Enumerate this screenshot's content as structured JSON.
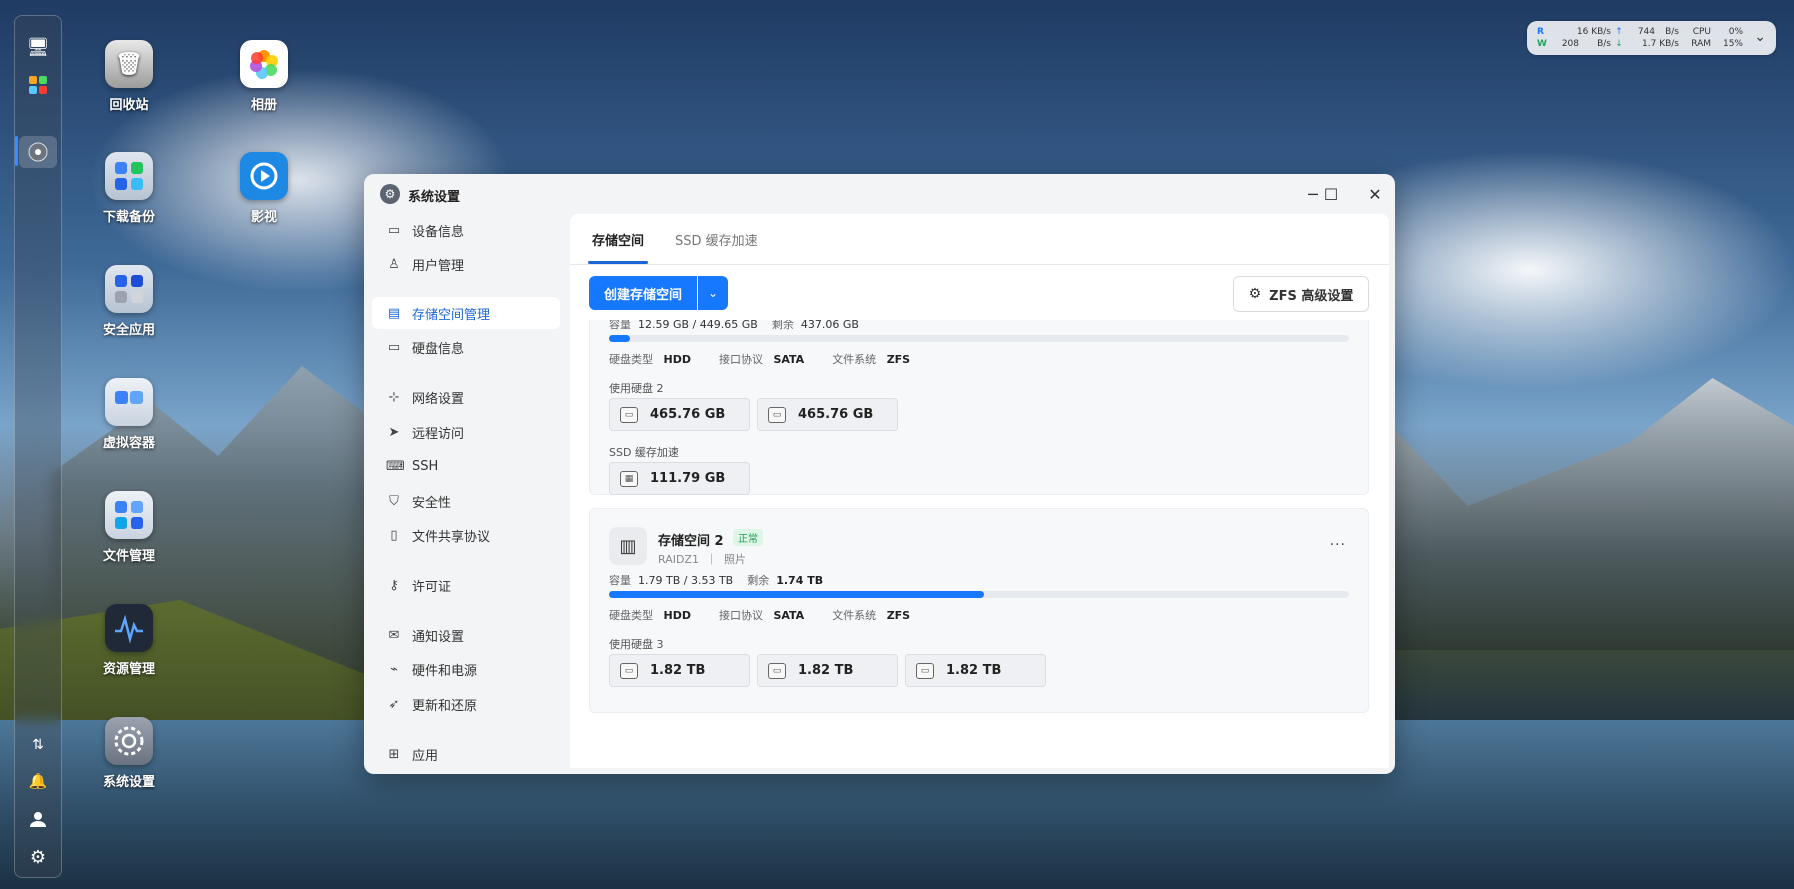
{
  "desktop": {
    "icons": [
      {
        "label": "回收站",
        "icon": "trash-icon"
      },
      {
        "label": "相册",
        "icon": "photos-icon"
      },
      {
        "label": "下载备份",
        "icon": "download-backup-icon"
      },
      {
        "label": "影视",
        "icon": "video-icon"
      },
      {
        "label": "安全应用",
        "icon": "security-apps-icon"
      },
      {
        "label": "虚拟容器",
        "icon": "virtual-container-icon"
      },
      {
        "label": "文件管理",
        "icon": "file-manager-icon"
      },
      {
        "label": "资源管理",
        "icon": "resource-monitor-icon"
      },
      {
        "label": "系统设置",
        "icon": "settings-icon"
      }
    ]
  },
  "status_widget": {
    "r_label": "R",
    "r_speed": "16 KB/s",
    "r_up": "744",
    "r_unit": "B/s",
    "cpu_label": "CPU",
    "cpu_value": "0%",
    "w_label": "W",
    "w_speed": "208",
    "w_speed_unit": "B/s",
    "w_down": "1.7 KB/s",
    "ram_label": "RAM",
    "ram_value": "15%"
  },
  "window": {
    "title": "系统设置",
    "nav": [
      {
        "label": "设备信息",
        "icon": "device-icon"
      },
      {
        "label": "用户管理",
        "icon": "user-icon"
      },
      {
        "label": "存储空间管理",
        "icon": "storage-icon",
        "active": true
      },
      {
        "label": "硬盘信息",
        "icon": "disk-icon"
      },
      {
        "label": "网络设置",
        "icon": "network-icon"
      },
      {
        "label": "远程访问",
        "icon": "remote-icon"
      },
      {
        "label": "SSH",
        "icon": "ssh-icon"
      },
      {
        "label": "安全性",
        "icon": "shield-icon"
      },
      {
        "label": "文件共享协议",
        "icon": "file-share-icon"
      },
      {
        "label": "许可证",
        "icon": "license-icon"
      },
      {
        "label": "通知设置",
        "icon": "mail-icon"
      },
      {
        "label": "硬件和电源",
        "icon": "power-icon"
      },
      {
        "label": "更新和还原",
        "icon": "rocket-icon"
      },
      {
        "label": "应用",
        "icon": "apps-icon"
      }
    ],
    "tabs": [
      "存储空间",
      "SSD 缓存加速"
    ],
    "create_button": "创建存储空间",
    "zfs_button": "ZFS 高级设置",
    "pool1": {
      "capacity_label": "容量",
      "capacity_value": "12.59 GB / 449.65 GB",
      "remain_label": "剩余",
      "remain_value": "437.06 GB",
      "usage_fraction": 0.028,
      "disk_type_label": "硬盘类型",
      "disk_type": "HDD",
      "protocol_label": "接口协议",
      "protocol": "SATA",
      "fs_label": "文件系统",
      "fs": "ZFS",
      "used_disks_label": "使用硬盘 2",
      "disks": [
        "465.76 GB",
        "465.76 GB"
      ],
      "ssd_label": "SSD 缓存加速",
      "ssd_disks": [
        "111.79 GB"
      ]
    },
    "pool2": {
      "name": "存储空间 2",
      "status": "正常",
      "raid": "RAIDZ1",
      "tag": "照片",
      "capacity_label": "容量",
      "capacity_value": "1.79 TB / 3.53 TB",
      "remain_label": "剩余",
      "remain_value": "1.74 TB",
      "usage_fraction": 0.507,
      "disk_type_label": "硬盘类型",
      "disk_type": "HDD",
      "protocol_label": "接口协议",
      "protocol": "SATA",
      "fs_label": "文件系统",
      "fs": "ZFS",
      "used_disks_label": "使用硬盘 3",
      "disks": [
        "1.82 TB",
        "1.82 TB",
        "1.82 TB"
      ]
    }
  },
  "colors": {
    "accent": "#1677ff",
    "status_ok": "#1f9d55"
  }
}
